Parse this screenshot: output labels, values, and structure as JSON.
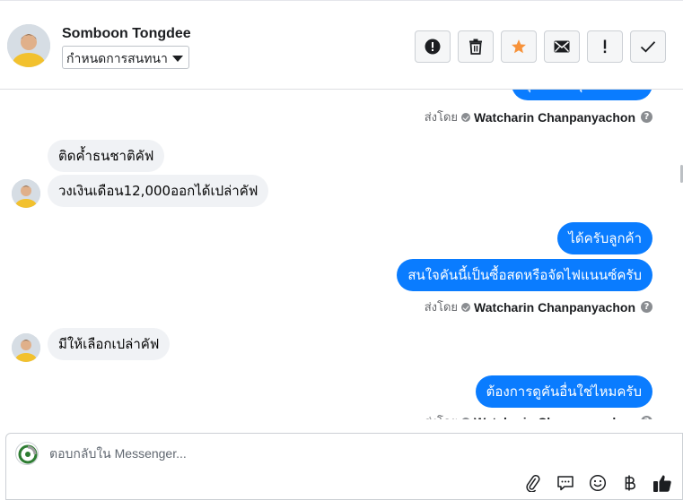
{
  "header": {
    "contact_name": "Somboon Tongdee",
    "label_select_value": "กำหนดการสนทนา",
    "toolbar": [
      {
        "icon": "alert-circle-icon"
      },
      {
        "icon": "trash-icon"
      },
      {
        "icon": "star-icon"
      },
      {
        "icon": "envelope-icon"
      },
      {
        "icon": "exclamation-icon"
      },
      {
        "icon": "checkmark-icon"
      }
    ]
  },
  "messages": {
    "sent_by_prefix": "ส่งโดย",
    "agent_name": "Watcharin Chanpanyachon",
    "partial_top_text": "คุณสนใจรุ่นไหนครับ",
    "incoming_1": "ติดค้ำธนชาติคัฟ",
    "incoming_2": "วงเงินเดือน12,000ออกได้เปล่าคัฟ",
    "outgoing_1": "ได้ครับลูกค้า",
    "outgoing_2": "สนใจคันนี้เป็นซื้อสดหรือจัดไฟแนนซ์ครับ",
    "incoming_3": "มีให้เลือกเปล่าคัฟ",
    "outgoing_3": "ต้องการดูคันอื่นใช่ไหมครับ"
  },
  "composer": {
    "placeholder": "ตอบกลับใน Messenger...",
    "icons": [
      "paperclip-icon",
      "saved-reply-icon",
      "emoji-icon",
      "baht-icon",
      "thumbs-up-icon"
    ]
  },
  "colors": {
    "outgoing_bubble": "#0a7cff",
    "incoming_bubble": "#f0f2f5",
    "star": "#f7923a",
    "like": "#1c1e21"
  }
}
